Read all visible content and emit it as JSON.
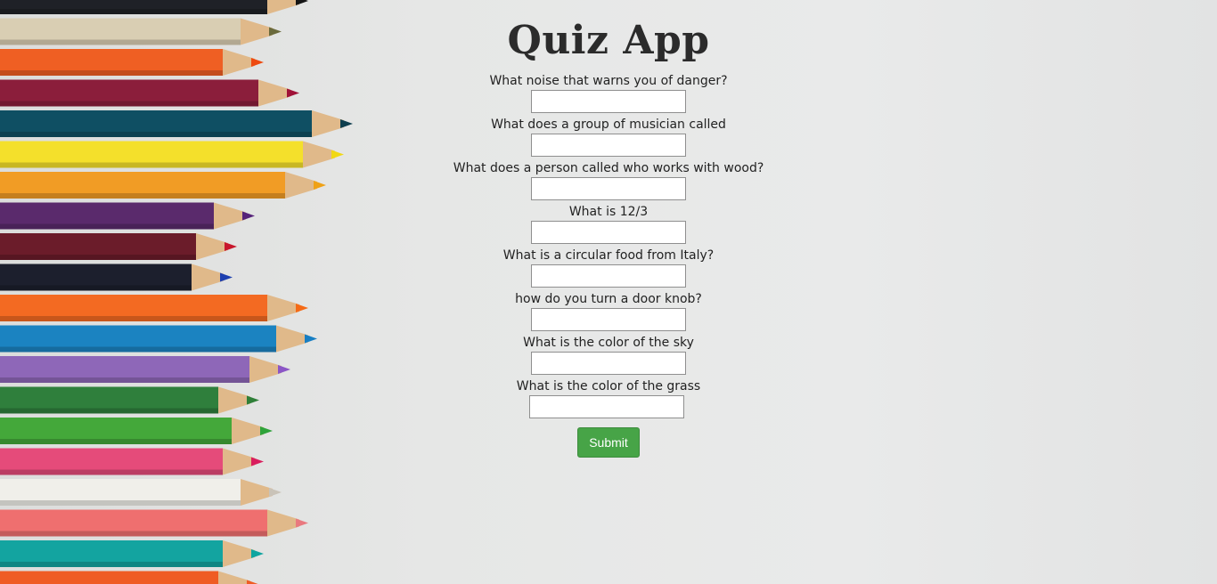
{
  "app": {
    "title": "Quiz App"
  },
  "questions": [
    {
      "label": "What noise that warns you of danger?",
      "value": ""
    },
    {
      "label": "What does a group of musician called",
      "value": ""
    },
    {
      "label": "What does a person called who works with wood?",
      "value": ""
    },
    {
      "label": "What is 12/3",
      "value": ""
    },
    {
      "label": "What is a circular food from Italy?",
      "value": ""
    },
    {
      "label": "how do you turn a door knob?",
      "value": ""
    },
    {
      "label": "What is the color of the sky",
      "value": ""
    },
    {
      "label": "What is the color of the grass",
      "value": ""
    }
  ],
  "submit": {
    "label": "Submit"
  },
  "colors": {
    "submit_bg": "#47a447",
    "title": "#2b2b2b",
    "background": "#e3e4e3"
  },
  "pencils": [
    {
      "body": "#1f2127",
      "tip": "#151515"
    },
    {
      "body": "#d9ceb3",
      "tip": "#6a6a3c"
    },
    {
      "body": "#ef5f23",
      "tip": "#ee4a10"
    },
    {
      "body": "#8b1e3b",
      "tip": "#a01238"
    },
    {
      "body": "#0f4f63",
      "tip": "#0e3f4f"
    },
    {
      "body": "#f4e02b",
      "tip": "#f1d813"
    },
    {
      "body": "#f19c25",
      "tip": "#efa116"
    },
    {
      "body": "#5a2a6c",
      "tip": "#56237a"
    },
    {
      "body": "#6b1c2a",
      "tip": "#c8162b"
    },
    {
      "body": "#1c1f2d",
      "tip": "#1d3fb0"
    },
    {
      "body": "#f36a22",
      "tip": "#f56a16"
    },
    {
      "body": "#1b83c1",
      "tip": "#177ec3"
    },
    {
      "body": "#8e67b8",
      "tip": "#8b56c6"
    },
    {
      "body": "#2f7f3c",
      "tip": "#2f7f38"
    },
    {
      "body": "#44a83a",
      "tip": "#2ea33a"
    },
    {
      "body": "#e54b7a",
      "tip": "#d91d5d"
    },
    {
      "body": "#f0efea",
      "tip": "#c9c3b8"
    },
    {
      "body": "#ef6f6f",
      "tip": "#e9797f"
    },
    {
      "body": "#13a4a0",
      "tip": "#0fa5a0"
    },
    {
      "body": "#ef5c24",
      "tip": "#ef5c24"
    }
  ]
}
